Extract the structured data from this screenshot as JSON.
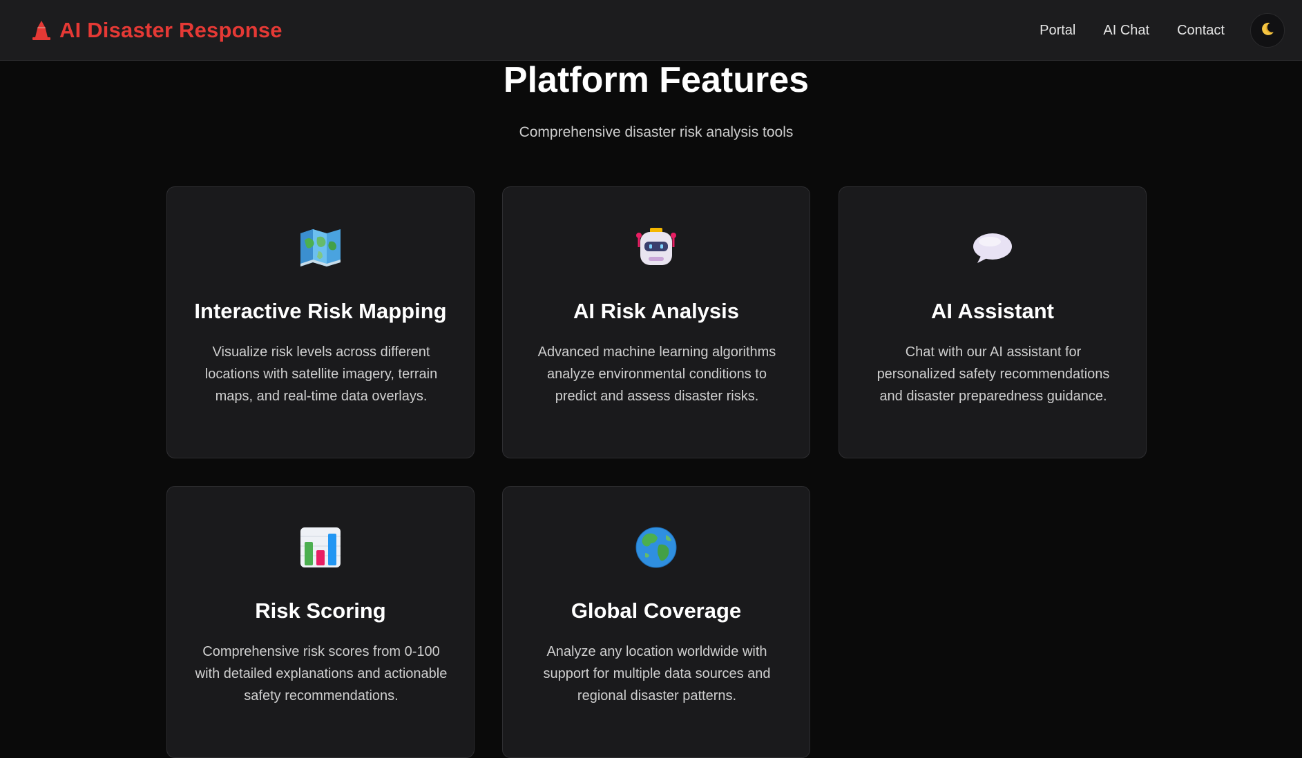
{
  "brand": {
    "name": "AI Disaster Response",
    "icon": "red-cone-icon",
    "color": "#e53935"
  },
  "nav": {
    "links": [
      {
        "label": "Portal"
      },
      {
        "label": "AI Chat"
      },
      {
        "label": "Contact"
      }
    ],
    "theme_toggle_icon": "moon-icon"
  },
  "features": {
    "title": "Platform Features",
    "subtitle": "Comprehensive disaster risk analysis tools",
    "cards": [
      {
        "icon": "world-map-icon",
        "title": "Interactive Risk Mapping",
        "description": "Visualize risk levels across different locations with satellite imagery, terrain maps, and real-time data overlays."
      },
      {
        "icon": "robot-icon",
        "title": "AI Risk Analysis",
        "description": "Advanced machine learning algorithms analyze environmental conditions to predict and assess disaster risks."
      },
      {
        "icon": "speech-bubble-icon",
        "title": "AI Assistant",
        "description": "Chat with our AI assistant for personalized safety recommendations and disaster preparedness guidance."
      },
      {
        "icon": "bar-chart-icon",
        "title": "Risk Scoring",
        "description": "Comprehensive risk scores from 0-100 with detailed explanations and actionable safety recommendations."
      },
      {
        "icon": "globe-icon",
        "title": "Global Coverage",
        "description": "Analyze any location worldwide with support for multiple data sources and regional disaster patterns."
      }
    ]
  }
}
